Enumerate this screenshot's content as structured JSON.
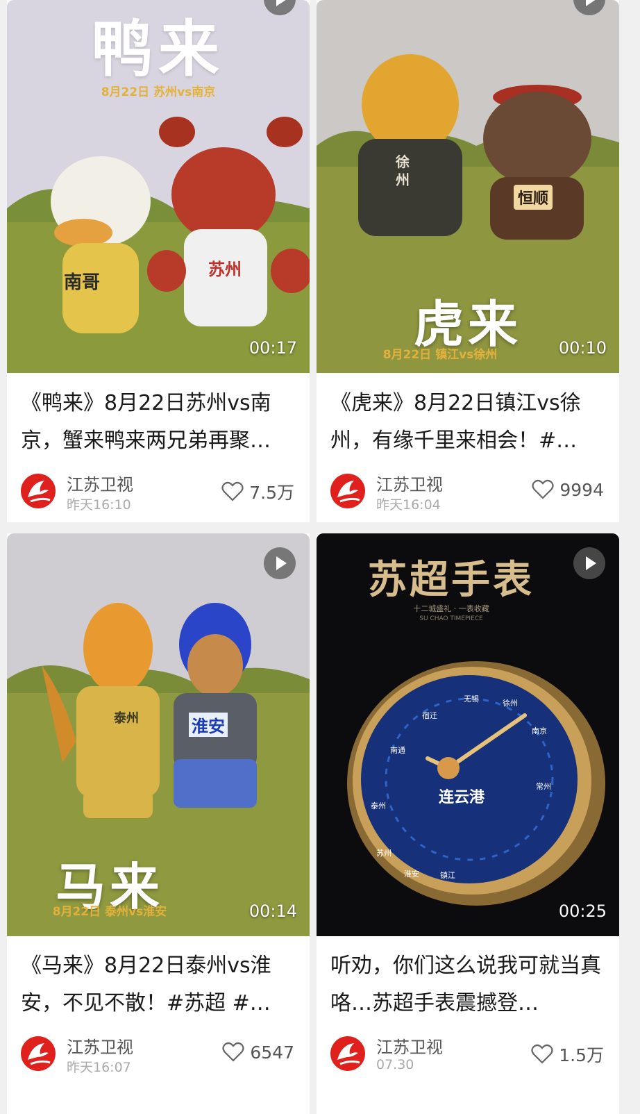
{
  "cards": [
    {
      "thumb_title": "鸭来",
      "thumb_subtitle": "8月22日 苏州vs南京",
      "duration": "00:17",
      "title": "《鸭来》8月22日苏州vs南京，蟹来鸭来两兄弟再聚…",
      "author": "江苏卫视",
      "time": "昨天16:10",
      "likes": "7.5万",
      "shirt_labels": [
        "南哥",
        "苏州"
      ]
    },
    {
      "thumb_title": "虎来",
      "thumb_subtitle": "8月22日 镇江vs徐州",
      "duration": "00:10",
      "title": "《虎来》8月22日镇江vs徐州，有缘千里来相会！#…",
      "author": "江苏卫视",
      "time": "昨天16:04",
      "likes": "9994",
      "shirt_labels": [
        "徐州",
        "恒顺"
      ]
    },
    {
      "thumb_title": "马来",
      "thumb_subtitle": "8月22日 泰州vs淮安",
      "duration": "00:14",
      "title": "《马来》8月22日泰州vs淮安，不见不散！#苏超  #…",
      "author": "江苏卫视",
      "time": "昨天16:07",
      "likes": "6547",
      "shirt_labels": [
        "泰州",
        "淮安"
      ]
    },
    {
      "thumb_title": "苏超手表",
      "thumb_subtitle": "十二城盛礼 · 一表收藏",
      "thumb_caption": "SU CHAO TIMEPIECE",
      "duration": "00:25",
      "title": "听劝，你们这么说我可就当真咯…苏超手表震撼登…",
      "author": "江苏卫视",
      "time": "07.30",
      "likes": "1.5万",
      "clock_center": "连云港",
      "clock_cities": [
        "无锡",
        "徐州",
        "南京",
        "常州",
        "镇江",
        "淮安",
        "苏州",
        "泰州",
        "南通",
        "宿迁"
      ]
    }
  ],
  "colors": {
    "brand_red": "#e0201c",
    "gold": "#e2b13c"
  }
}
